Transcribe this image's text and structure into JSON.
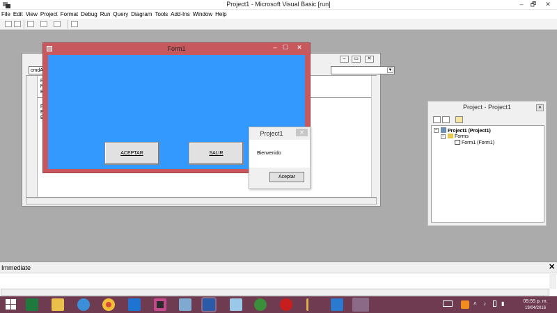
{
  "window": {
    "title": "Project1 - Microsoft Visual Basic [run]",
    "min": "–",
    "max": "🗗",
    "close": "✕"
  },
  "menu": [
    "File",
    "Edit",
    "View",
    "Project",
    "Format",
    "Debug",
    "Run",
    "Query",
    "Diagram",
    "Tools",
    "Add-Ins",
    "Window",
    "Help"
  ],
  "code_window": {
    "object_combo": "cmdA",
    "lines_top": [
      "P",
      "M",
      "E"
    ],
    "lines_bottom": [
      "P",
      "E",
      "E"
    ]
  },
  "form1": {
    "title": "Form1",
    "client_color": "#3399ff",
    "buttons": {
      "accept": "ACEPTAR",
      "exit": "SALIR"
    }
  },
  "msgbox": {
    "title": "Project1",
    "text": "Bienvenido",
    "ok": "Aceptar",
    "close": "✕"
  },
  "project_explorer": {
    "title": "Project - Project1",
    "root": "Project1 (Project1)",
    "folder": "Forms",
    "form": "Form1 (Form1)"
  },
  "immediate": {
    "title": "Immediate",
    "close": "✕"
  },
  "taskbar": {
    "icons": [
      "windows-start",
      "excel",
      "file-explorer",
      "internet-explorer",
      "chrome",
      "dropbox",
      "game-app",
      "network-app",
      "word",
      "notepad-app",
      "dreamweaver",
      "flash",
      "quill-app",
      "gimp-app",
      "vb6"
    ],
    "clock_time": "05:55 p. m.",
    "clock_date": "19/04/2016"
  },
  "colors": {
    "taskbar": "#6e3b51",
    "form_border": "#c6585e",
    "workspace": "#ababab"
  }
}
